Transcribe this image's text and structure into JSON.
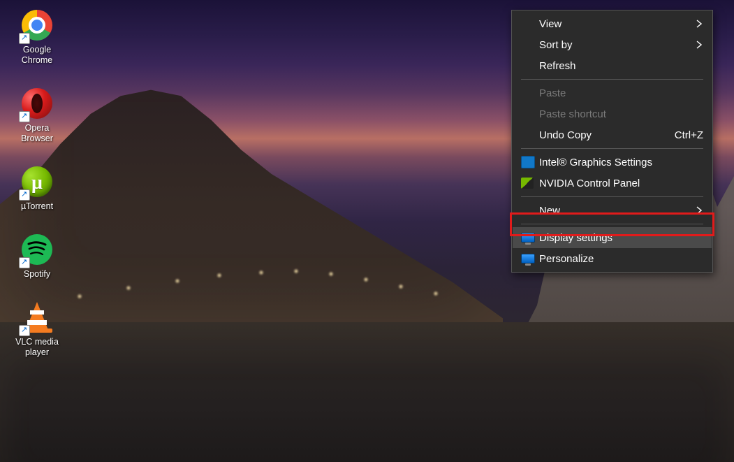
{
  "desktop_icons": [
    {
      "id": "chrome",
      "label": "Google\nChrome"
    },
    {
      "id": "opera",
      "label": "Opera\nBrowser"
    },
    {
      "id": "utorrent",
      "label": "µTorrent"
    },
    {
      "id": "spotify",
      "label": "Spotify"
    },
    {
      "id": "vlc",
      "label": "VLC media\nplayer"
    }
  ],
  "context_menu": {
    "items": [
      {
        "label": "View",
        "submenu": true
      },
      {
        "label": "Sort by",
        "submenu": true
      },
      {
        "label": "Refresh"
      },
      {
        "sep": true
      },
      {
        "label": "Paste",
        "disabled": true
      },
      {
        "label": "Paste shortcut",
        "disabled": true
      },
      {
        "label": "Undo Copy",
        "shortcut": "Ctrl+Z"
      },
      {
        "sep": true
      },
      {
        "label": "Intel® Graphics Settings",
        "icon": "intel"
      },
      {
        "label": "NVIDIA Control Panel",
        "icon": "nvidia"
      },
      {
        "sep": true
      },
      {
        "label": "New",
        "submenu": true
      },
      {
        "sep": true
      },
      {
        "label": "Display settings",
        "icon": "monitor",
        "highlighted": true
      },
      {
        "label": "Personalize",
        "icon": "monitor"
      }
    ]
  }
}
